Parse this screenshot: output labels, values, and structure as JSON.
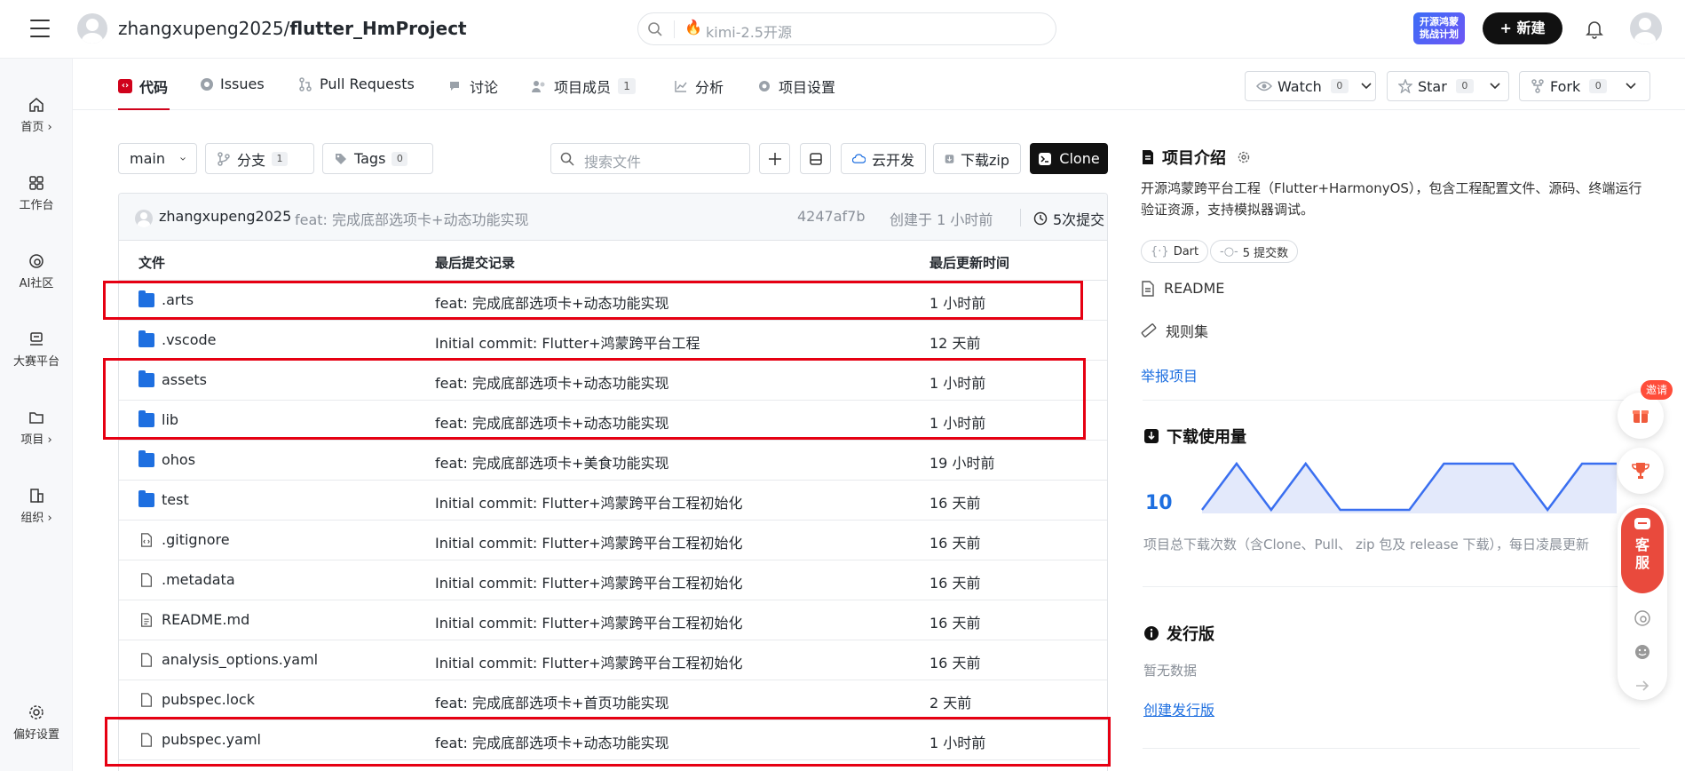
{
  "header": {
    "repo_owner": "zhangxupeng2025/",
    "repo_name": "flutter_HmProject",
    "search_hint": "kimi-2.5开源",
    "promo_badge": "开源鸿蒙\n挑战计划",
    "new_label": "+ 新建"
  },
  "leftnav": {
    "items": [
      {
        "label": "首页 ›",
        "icon": "home-icon"
      },
      {
        "label": "工作台",
        "icon": "workbench-icon"
      },
      {
        "label": "AI社区",
        "icon": "ai-community-icon"
      },
      {
        "label": "大赛平台",
        "icon": "contest-icon"
      },
      {
        "label": "项目 ›",
        "icon": "folder-icon"
      },
      {
        "label": "组织 ›",
        "icon": "org-icon"
      }
    ],
    "settings_label": "偏好设置"
  },
  "tabs": {
    "code": "代码",
    "issues": "Issues",
    "pull_requests": "Pull Requests",
    "discussion": "讨论",
    "members": "项目成员",
    "members_count": "1",
    "analysis": "分析",
    "settings": "项目设置"
  },
  "actions": {
    "watch": "Watch",
    "watch_count": "0",
    "star": "Star",
    "star_count": "0",
    "fork": "Fork",
    "fork_count": "0"
  },
  "toolbar": {
    "branch": "main",
    "branches_label": "分支",
    "branches_count": "1",
    "tags_label": "Tags",
    "tags_count": "0",
    "search_placeholder": "搜索文件",
    "cloud_dev": "云开发",
    "download_zip": "下载zip",
    "clone": "Clone"
  },
  "last_commit": {
    "author": "zhangxupeng2025",
    "message": "feat: 完成底部选项卡+动态功能实现",
    "hash": "4247af7b",
    "time": "创建于 1 小时前",
    "commits": "5次提交"
  },
  "table": {
    "headers": [
      "文件",
      "最后提交记录",
      "最后更新时间"
    ],
    "rows": [
      {
        "name": ".arts",
        "type": "folder",
        "message": "feat: 完成底部选项卡+动态功能实现",
        "time": "1 小时前"
      },
      {
        "name": ".vscode",
        "type": "folder",
        "message": "Initial commit: Flutter+鸿蒙跨平台工程",
        "time": "12 天前"
      },
      {
        "name": "assets",
        "type": "folder",
        "message": "feat: 完成底部选项卡+动态功能实现",
        "time": "1 小时前"
      },
      {
        "name": "lib",
        "type": "folder",
        "message": "feat: 完成底部选项卡+动态功能实现",
        "time": "1 小时前"
      },
      {
        "name": "ohos",
        "type": "folder",
        "message": "feat: 完成底部选项卡+美食功能实现",
        "time": "19 小时前"
      },
      {
        "name": "test",
        "type": "folder",
        "message": "Initial commit: Flutter+鸿蒙跨平台工程初始化",
        "time": "16 天前"
      },
      {
        "name": ".gitignore",
        "type": "file-code",
        "message": "Initial commit: Flutter+鸿蒙跨平台工程初始化",
        "time": "16 天前"
      },
      {
        "name": ".metadata",
        "type": "file",
        "message": "Initial commit: Flutter+鸿蒙跨平台工程初始化",
        "time": "16 天前"
      },
      {
        "name": "README.md",
        "type": "file-doc",
        "message": "Initial commit: Flutter+鸿蒙跨平台工程初始化",
        "time": "16 天前"
      },
      {
        "name": "analysis_options.yaml",
        "type": "file",
        "message": "Initial commit: Flutter+鸿蒙跨平台工程初始化",
        "time": "16 天前"
      },
      {
        "name": "pubspec.lock",
        "type": "file",
        "message": "feat: 完成底部选项卡+首页功能实现",
        "time": "2 天前"
      },
      {
        "name": "pubspec.yaml",
        "type": "file",
        "message": "feat: 完成底部选项卡+动态功能实现",
        "time": "1 小时前"
      }
    ]
  },
  "sidebar": {
    "intro_title": "项目介绍",
    "description": "开源鸿蒙跨平台工程（Flutter+HarmonyOS），包含工程配置文件、源码、终端运行验证资源，支持模拟器调试。",
    "lang_tag": "Dart",
    "commits_tag": "5 提交数",
    "readme": "README",
    "rules": "规则集",
    "report": "举报项目",
    "downloads_title": "下载使用量",
    "downloads_count": "10",
    "downloads_trend": [
      10,
      11.8,
      10,
      11.8,
      10,
      10,
      10,
      11.8,
      11.8,
      11.8,
      10,
      11.8,
      11.8
    ],
    "downloads_note": "项目总下载次数（含Clone、Pull、 zip 包及 release 下载），每日凌晨更新",
    "releases_title": "发行版",
    "releases_empty": "暂无数据",
    "create_release": "创建发行版"
  },
  "floating": {
    "invite": "邀请",
    "customer_service": "客服"
  },
  "colors": {
    "accent_red": "#d0021b",
    "highlight_red": "#e60012",
    "link_blue": "#1e6fe0"
  }
}
